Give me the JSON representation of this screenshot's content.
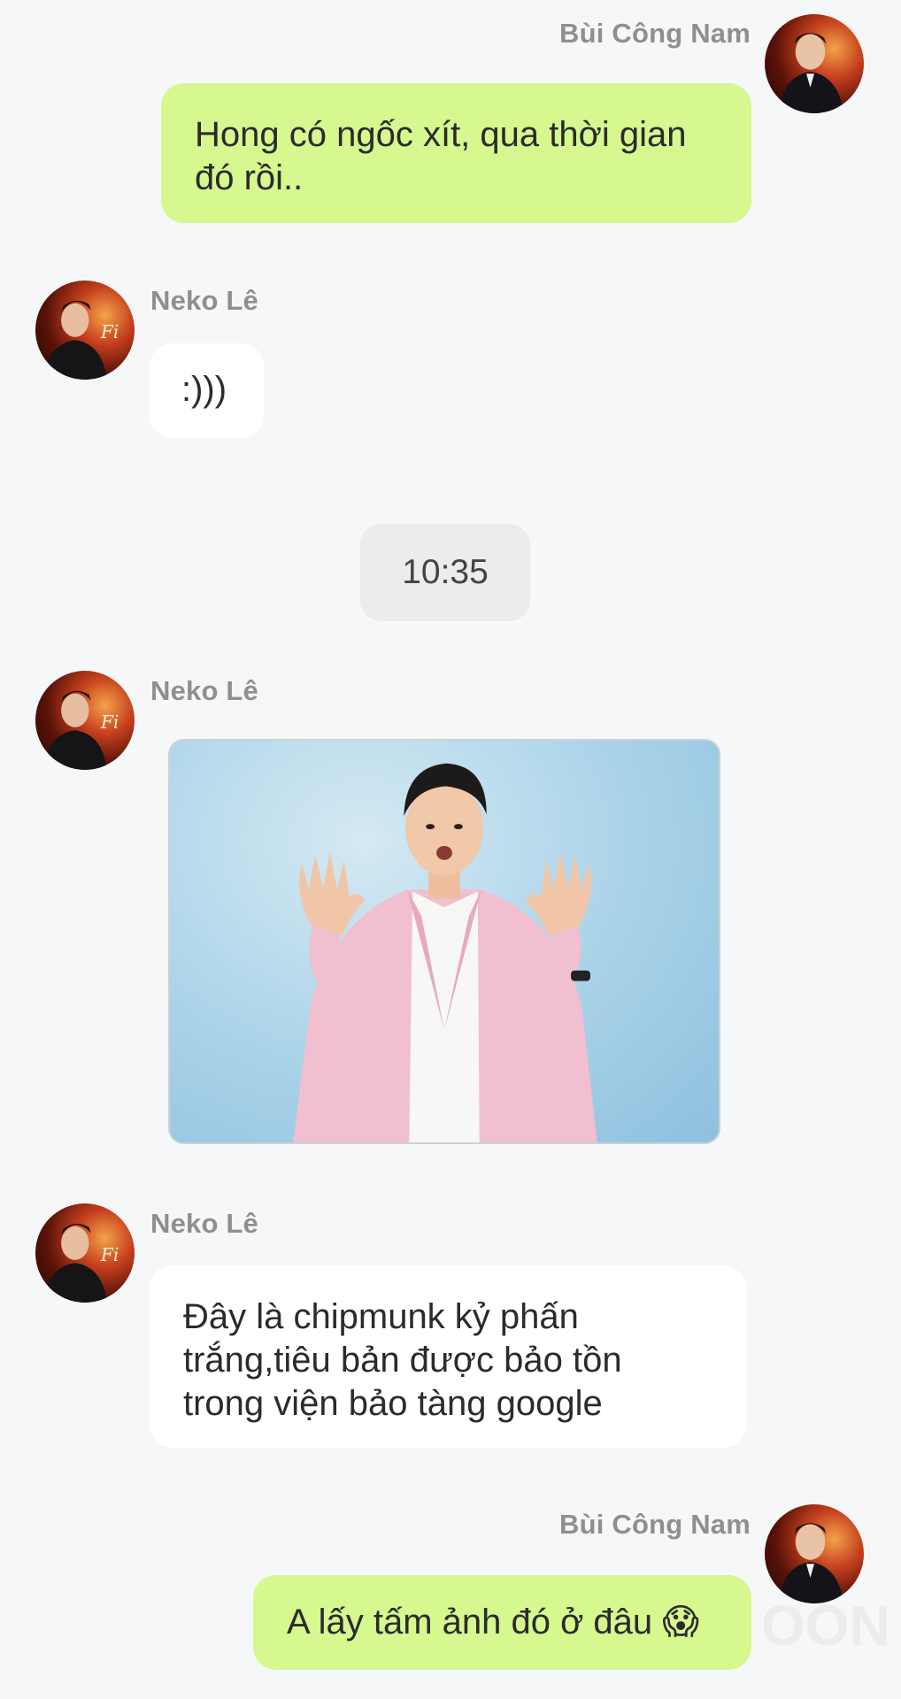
{
  "messages": [
    {
      "sender": "Bùi Công Nam",
      "side": "right",
      "lines": [
        "Hong có ngốc xít, qua thời gian",
        "đó rồi.."
      ]
    },
    {
      "sender": "Neko Lê",
      "side": "left",
      "lines": [
        ":)))"
      ]
    },
    {
      "type": "timestamp",
      "text": "10:35"
    },
    {
      "sender": "Neko Lê",
      "side": "left",
      "type": "image"
    },
    {
      "sender": "Neko Lê",
      "side": "left",
      "lines": [
        "Đây là chipmunk kỷ phấn",
        "trắng,tiêu bản được bảo tồn",
        "trong viện bảo tàng google"
      ]
    },
    {
      "sender": "Bùi Công Nam",
      "side": "right",
      "lines": [
        "A lấy tấm ảnh đó ở đâu 😱"
      ]
    }
  ],
  "watermark": "OON",
  "colors": {
    "my_bubble": "#d7f78f",
    "their_bubble": "#ffffff",
    "background": "#f6f7f9",
    "name_text": "#8f8f8f"
  }
}
